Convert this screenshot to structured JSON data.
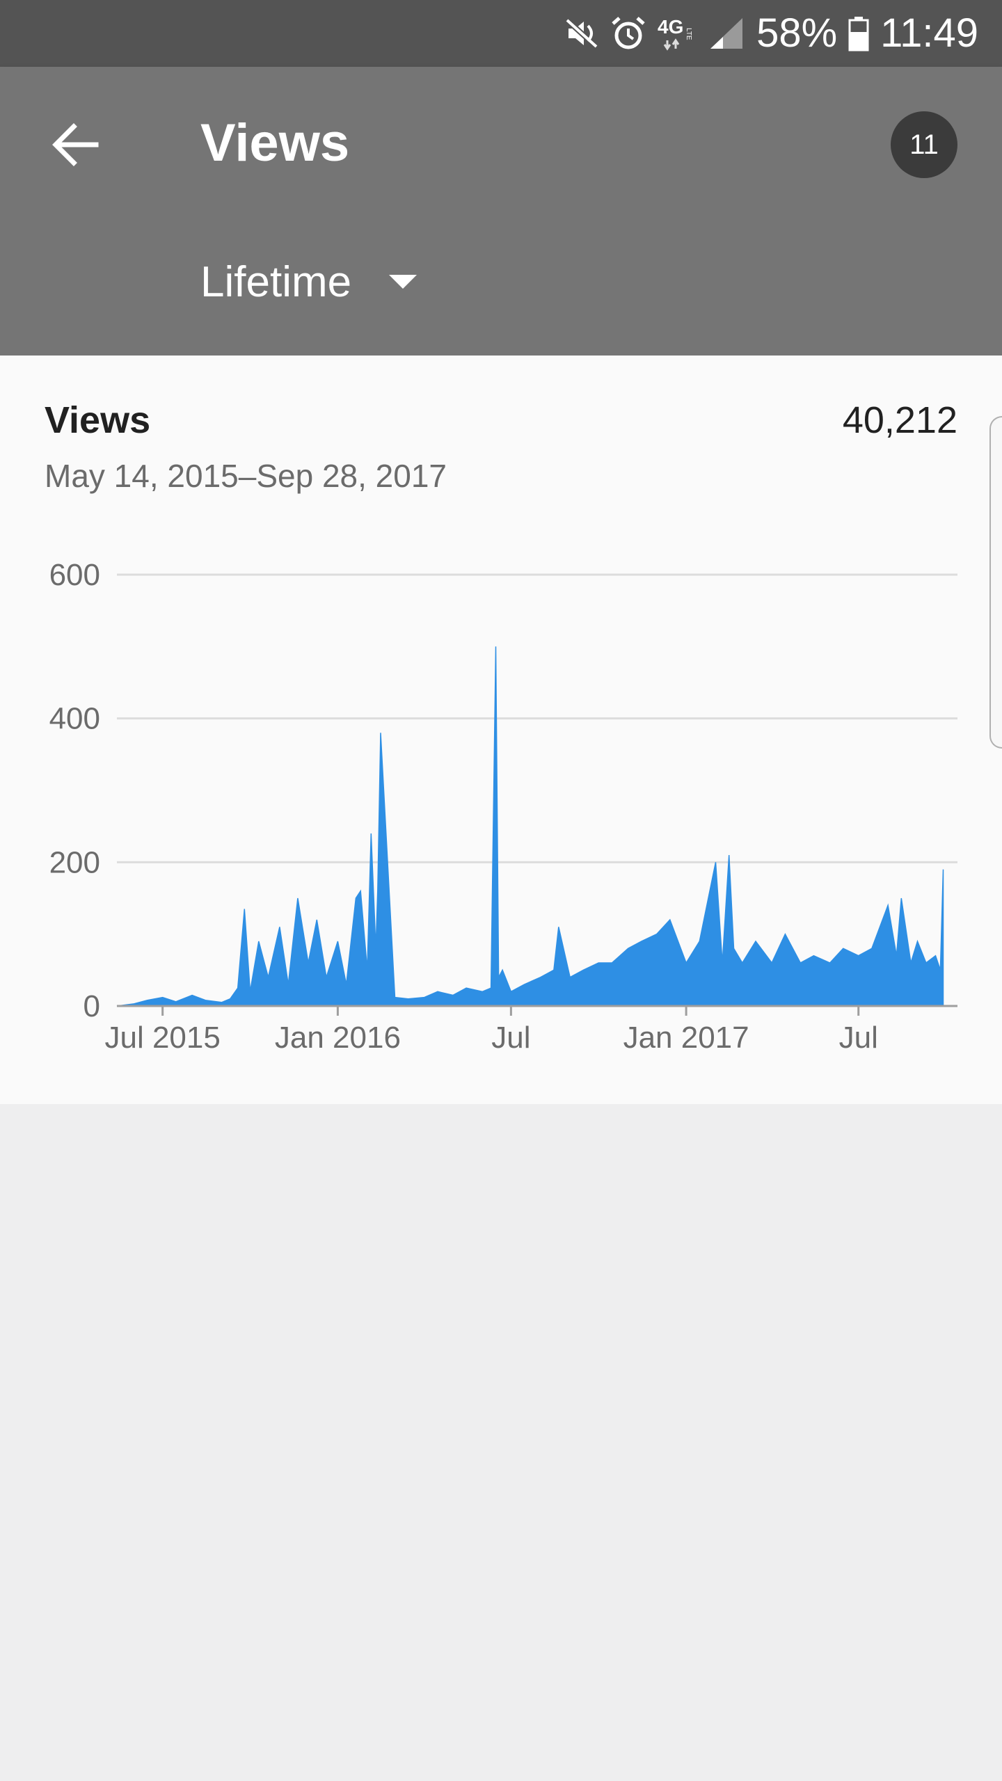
{
  "status_bar": {
    "battery": "58%",
    "time": "11:49",
    "icons": [
      "mute-icon",
      "alarm-icon",
      "4g-lte-icon",
      "signal-icon",
      "battery-icon"
    ]
  },
  "app_bar": {
    "title": "Views",
    "badge": "11",
    "period": "Lifetime"
  },
  "card": {
    "title": "Views",
    "total": "40,212",
    "date_range": "May 14, 2015–Sep 28, 2017"
  },
  "colors": {
    "status_bar": "#545454",
    "app_bar": "#757575",
    "series": "#2e8fe4",
    "page_background": "#eeeeef"
  },
  "chart_data": {
    "type": "area",
    "title": "",
    "xlabel": "",
    "ylabel": "",
    "ylim": [
      0,
      600
    ],
    "yticks": [
      "0",
      "200",
      "400",
      "600"
    ],
    "xticks": [
      "Jul 2015",
      "Jan 2016",
      "Jul",
      "Jan 2017",
      "Jul"
    ],
    "grid": true,
    "legend": "none",
    "series": [
      {
        "x": [
          "2015-05-14",
          "2015-06-01",
          "2015-06-15",
          "2015-07-01",
          "2015-07-15",
          "2015-08-01",
          "2015-08-15",
          "2015-09-01",
          "2015-09-10",
          "2015-09-18",
          "2015-09-25",
          "2015-10-01",
          "2015-10-10",
          "2015-10-20",
          "2015-11-01",
          "2015-11-10",
          "2015-11-20",
          "2015-12-01",
          "2015-12-10",
          "2015-12-20",
          "2016-01-01",
          "2016-01-10",
          "2016-01-20",
          "2016-01-25",
          "2016-02-01",
          "2016-02-05",
          "2016-02-10",
          "2016-02-12",
          "2016-02-15",
          "2016-03-01",
          "2016-03-15",
          "2016-04-01",
          "2016-04-15",
          "2016-05-01",
          "2016-05-15",
          "2016-06-01",
          "2016-06-10",
          "2016-06-15",
          "2016-06-18",
          "2016-06-22",
          "2016-07-01",
          "2016-07-15",
          "2016-08-01",
          "2016-08-15",
          "2016-08-20",
          "2016-09-01",
          "2016-09-15",
          "2016-10-01",
          "2016-10-15",
          "2016-11-01",
          "2016-11-15",
          "2016-12-01",
          "2016-12-15",
          "2017-01-01",
          "2017-01-15",
          "2017-02-01",
          "2017-02-08",
          "2017-02-15",
          "2017-02-20",
          "2017-03-01",
          "2017-03-15",
          "2017-04-01",
          "2017-04-15",
          "2017-05-01",
          "2017-05-15",
          "2017-06-01",
          "2017-06-15",
          "2017-07-01",
          "2017-07-15",
          "2017-08-01",
          "2017-08-10",
          "2017-08-15",
          "2017-08-25",
          "2017-09-01",
          "2017-09-10",
          "2017-09-20",
          "2017-09-25",
          "2017-09-28"
        ],
        "y": [
          0,
          3,
          8,
          12,
          6,
          15,
          8,
          5,
          10,
          25,
          135,
          20,
          90,
          40,
          110,
          30,
          150,
          60,
          120,
          40,
          90,
          30,
          150,
          160,
          50,
          240,
          80,
          160,
          380,
          12,
          10,
          12,
          20,
          15,
          25,
          20,
          25,
          500,
          40,
          50,
          20,
          30,
          40,
          50,
          110,
          40,
          50,
          60,
          60,
          80,
          90,
          100,
          120,
          60,
          90,
          200,
          60,
          210,
          80,
          60,
          90,
          60,
          100,
          60,
          70,
          60,
          80,
          70,
          80,
          140,
          70,
          150,
          60,
          90,
          60,
          70,
          50,
          190
        ]
      }
    ]
  }
}
